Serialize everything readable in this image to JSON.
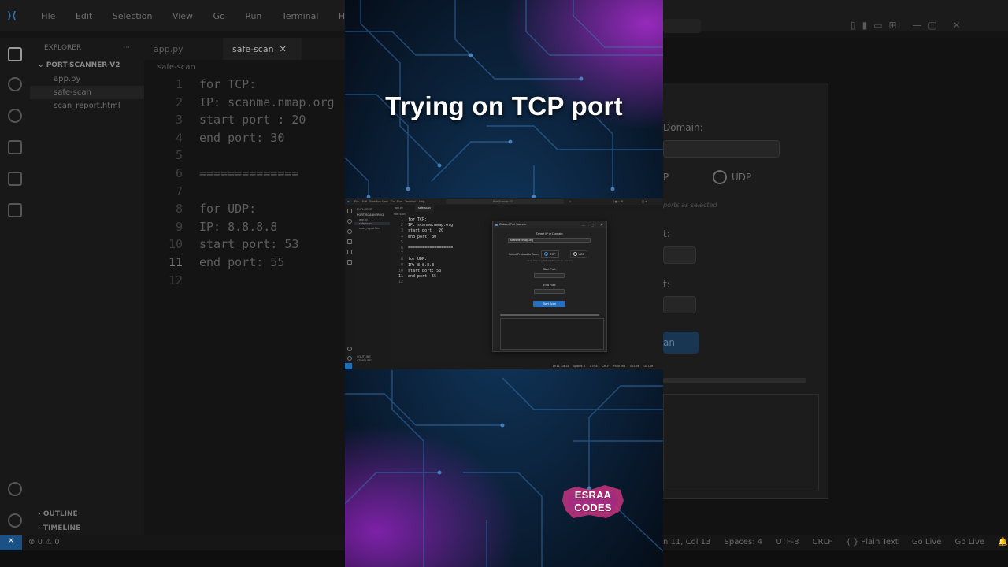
{
  "caption": "Trying on TCP port",
  "watermark": {
    "line1": "ESRAA",
    "line2": "CODES"
  },
  "colors": {
    "accent_blue": "#2570c0",
    "remote_blue": "#1f6fb8",
    "neon_purple": "#9b2fd0",
    "neon_blue": "#2a6fb8"
  },
  "background_editor": {
    "menu": [
      "File",
      "Edit",
      "Selection",
      "View",
      "Go",
      "Run",
      "Terminal",
      "Help"
    ],
    "explorer_title": "EXPLORER",
    "project": "PORT-SCANNER-V2",
    "files": [
      "app.py",
      "safe-scan",
      "scan_report.html"
    ],
    "tabs": [
      "app.py",
      "safe-scan"
    ],
    "breadcrumb": "safe-scan",
    "code": [
      {
        "n": "1",
        "t": "for TCP:"
      },
      {
        "n": "2",
        "t": "IP: scanme.nmap.org"
      },
      {
        "n": "3",
        "t": "start port : 20"
      },
      {
        "n": "4",
        "t": "end port: 30"
      },
      {
        "n": "5",
        "t": ""
      },
      {
        "n": "6",
        "t": "=============="
      },
      {
        "n": "7",
        "t": ""
      },
      {
        "n": "8",
        "t": "for UDP:"
      },
      {
        "n": "9",
        "t": "IP: 8.8.8.8"
      },
      {
        "n": "10",
        "t": "start port: 53"
      },
      {
        "n": "11",
        "t": "end port: 55"
      },
      {
        "n": "12",
        "t": ""
      }
    ],
    "outline": "OUTLINE",
    "timeline": "TIMELINE",
    "errors": "0",
    "warnings": "0",
    "right_fragments": {
      "domain": "Domain:",
      "udp": "UDP",
      "p_frag": "P",
      "hint_frag": "ports as selected",
      "t1": "t:",
      "t2": "t:",
      "an": "an"
    },
    "status_right": [
      "n 11, Col 13",
      "Spaces: 4",
      "UTF-8",
      "CRLF",
      "{ } Plain Text",
      "Go Live",
      "Go Live"
    ]
  },
  "mini_editor": {
    "menu": [
      "File",
      "Edit",
      "Selection",
      "View",
      "Go",
      "Run",
      "Terminal",
      "Help"
    ],
    "search": "Port Scanner V2",
    "explorer": "EXPLORER",
    "project": "PORT-SCANNER-V2",
    "files": [
      "app.py",
      "safe-scan",
      "scan_report.html"
    ],
    "tabs": [
      "app.py",
      "safe-scan"
    ],
    "breadcrumb": "safe-scan",
    "code": [
      {
        "n": "1",
        "t": "for TCP:"
      },
      {
        "n": "2",
        "t": "IP: scanme.nmap.org"
      },
      {
        "n": "3",
        "t": "start port : 20"
      },
      {
        "n": "4",
        "t": "end port: 30"
      },
      {
        "n": "5",
        "t": ""
      },
      {
        "n": "6",
        "t": "==================="
      },
      {
        "n": "7",
        "t": ""
      },
      {
        "n": "8",
        "t": "for UDP:"
      },
      {
        "n": "9",
        "t": "IP: 8.8.8.8"
      },
      {
        "n": "10",
        "t": "start port: 53"
      },
      {
        "n": "11",
        "t": "end port: 55"
      },
      {
        "n": "12",
        "t": ""
      }
    ],
    "outline": "OUTLINE",
    "timeline": "TIMELINE",
    "status_right": [
      "Ln 11, Col 13",
      "Spaces: 4",
      "UTF-8",
      "CRLF",
      "Plain Text",
      "Go Live",
      "Go Live"
    ]
  },
  "scanner": {
    "title": "Colored Port Scanner",
    "target_label": "Target IP or Domain:",
    "target_value": "scanme.nmap.org",
    "protocol_label": "Select Protocol to Scan:",
    "protocol_tcp": "TCP",
    "protocol_udp": "UDP",
    "selected_protocol": "TCP",
    "hint": "Note: Scanning TCP or UDP ports as selected",
    "start_port_label": "Start Port:",
    "start_port_value": "",
    "end_port_label": "End Port:",
    "end_port_value": "",
    "scan_button": "Start Scan"
  }
}
